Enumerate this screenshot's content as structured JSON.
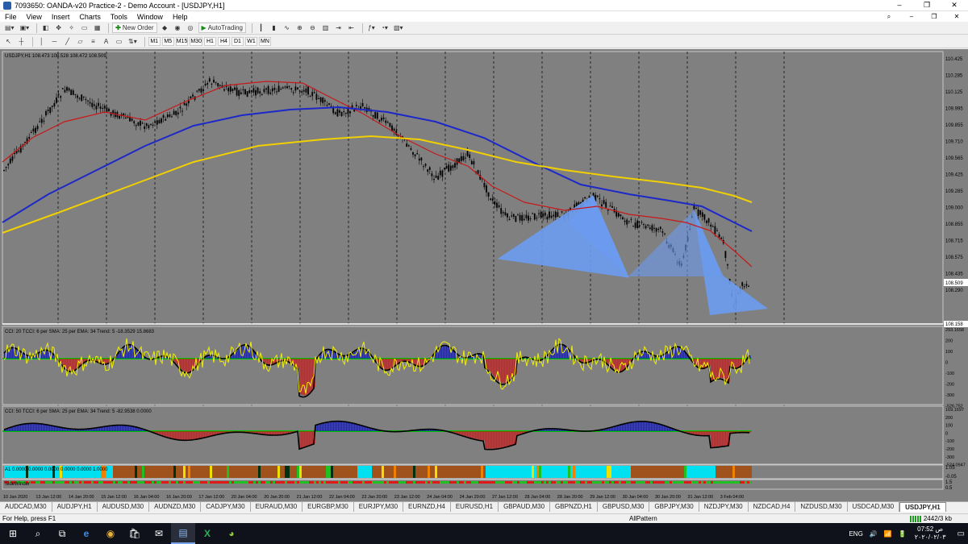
{
  "window": {
    "title": "7093650: OANDA-v20 Practice-2 - Demo Account - [USDJPY,H1]",
    "minimize": "–",
    "maximize": "❐",
    "close": "✕"
  },
  "menu": [
    "File",
    "View",
    "Insert",
    "Charts",
    "Tools",
    "Window",
    "Help"
  ],
  "menu_right": [
    "⌕",
    "–",
    "❐",
    "✕"
  ],
  "toolbar1": {
    "new_order": "New Order",
    "auto_trading": "AutoTrading"
  },
  "timeframes": [
    "M1",
    "M5",
    "M15",
    "M30",
    "H1",
    "H4",
    "D1",
    "W1",
    "MN"
  ],
  "chart": {
    "header": "USDJPY,H1  108.473 108.528 108.472 108.509",
    "price_labels": [
      "110.425",
      "110.285",
      "110.125",
      "109.995",
      "109.855",
      "109.710",
      "109.565",
      "109.425",
      "109.285",
      "109.000",
      "108.855",
      "108.715",
      "108.575",
      "108.435",
      "108.290"
    ],
    "current_price": "108.509",
    "last_price": "108.158",
    "cci1": {
      "header": "CCI: 20  TCCI: 6  per SMA: 25  per EMA: 34  Trend: 5  -18.3529 15.8683",
      "labels": [
        "293.1658",
        "200",
        "100",
        "0",
        "-100",
        "-200",
        "-300",
        "-526.752"
      ]
    },
    "cci2": {
      "header": "CCI: 50  TCCI: 6  per SMA: 25  per EMA: 34  Trend: 5  -82.9538 0.0000",
      "labels": [
        "169.1697",
        "200",
        "100",
        "0",
        "-100",
        "-200",
        "-300",
        "-524.0947"
      ]
    },
    "bar": {
      "header": "A1 0.0000 0.0000 0.0000 0.0000 0.0000 1.0000",
      "labels": [
        "1.05",
        "-0.05"
      ]
    },
    "bar2": {
      "header": "SideWinder",
      "labels": [
        "1.5",
        "0.5"
      ]
    },
    "time_labels": [
      "10 Jan 2020",
      "13 Jan 12:00",
      "14 Jan 20:00",
      "15 Jan 12:00",
      "16 Jan 04:00",
      "16 Jan 20:00",
      "17 Jan 12:00",
      "20 Jan 04:00",
      "20 Jan 20:00",
      "21 Jan 12:00",
      "22 Jan 04:00",
      "22 Jan 20:00",
      "23 Jan 12:00",
      "24 Jan 04:00",
      "24 Jan 20:00",
      "27 Jan 12:00",
      "28 Jan 04:00",
      "28 Jan 20:00",
      "29 Jan 12:00",
      "30 Jan 04:00",
      "30 Jan 20:00",
      "31 Jan 12:00",
      "3 Feb 04:00"
    ]
  },
  "tabs": [
    "AUDCAD,M30",
    "AUDJPY,H1",
    "AUDUSD,M30",
    "AUDNZD,M30",
    "CADJPY,M30",
    "EURAUD,M30",
    "EURGBP,M30",
    "EURJPY,M30",
    "EURNZD,H4",
    "EURUSD,H1",
    "GBPAUD,M30",
    "GBPNZD,H1",
    "GBPUSD,M30",
    "GBPJPY,M30",
    "NZDJPY,M30",
    "NZDCAD,H4",
    "NZDUSD,M30",
    "USDCAD,M30",
    "USDJPY,H1"
  ],
  "active_tab": "USDJPY,H1",
  "status": {
    "help": "For Help, press F1",
    "profile": "AllPattern",
    "traffic": "2442/3 kb"
  },
  "taskbar": {
    "icons": [
      "windows-start",
      "search",
      "task-view",
      "edge",
      "chrome",
      "store",
      "mail",
      "metatrader",
      "excel",
      "other-app"
    ],
    "tray": [
      "ENG",
      "🔊",
      "📶",
      "🔋"
    ],
    "time": "07:52 ص",
    "date": "٢٠٢٠/٠٢/٠٣"
  }
}
